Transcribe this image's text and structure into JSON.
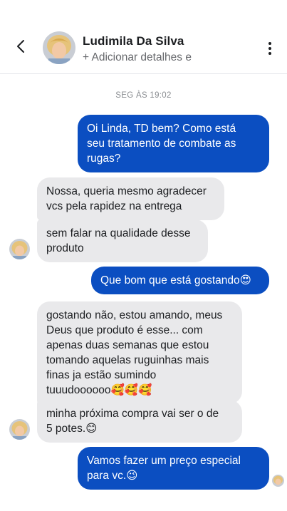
{
  "header": {
    "back_icon": "chevron-left-icon",
    "contact_name": "Ludimila Da Silva",
    "subtitle": "+ Adicionar detalhes e",
    "menu_icon": "more-vertical-icon"
  },
  "conversation": {
    "timestamp": "SEG ÀS 19:02",
    "messages": [
      {
        "sender": "me",
        "text": "Oi Linda, TD bem? Como está\nseu tratamento de combate as\nrugas?"
      },
      {
        "sender": "contact",
        "text": "Nossa, queria mesmo agradecer\nvcs pela rapidez na entrega"
      },
      {
        "sender": "contact",
        "text": "sem falar na qualidade desse\nproduto"
      },
      {
        "sender": "me",
        "text": "Que bom que está gostando😍"
      },
      {
        "sender": "contact",
        "text": "gostando não, estou amando, meus\nDeus que produto é esse... com\napenas duas semanas que estou\ntomando aquelas ruguinhas mais\nfinas ja estão sumindo\ntuuudoooooo🥰🥰🥰"
      },
      {
        "sender": "contact",
        "text": "minha próxima compra vai ser o de\n5 potes.😊"
      },
      {
        "sender": "me",
        "text": "Vamos fazer um preço especial\npara vc.😉"
      }
    ]
  },
  "colors": {
    "outgoing_bubble": "#0b4ec1",
    "incoming_bubble": "#e9e9eb",
    "timestamp": "#8a8d91"
  }
}
